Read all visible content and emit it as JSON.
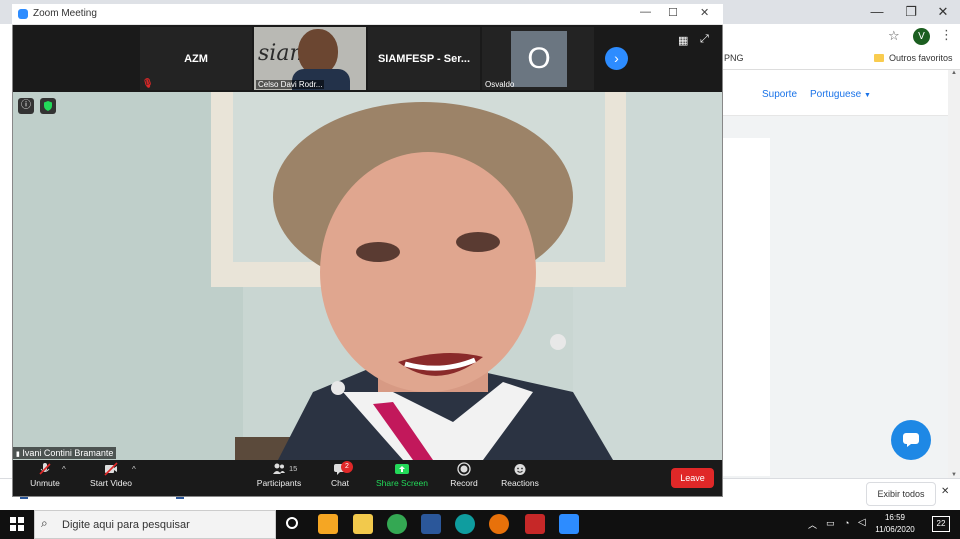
{
  "browser": {
    "bookmark_png": "PNG",
    "bookmark_folder": "Outros favoritos",
    "profile_initial": "V",
    "nav_support": "Suporte",
    "nav_language": "Portuguese",
    "show_all": "Exibir todos",
    "win_min": "—",
    "win_max": "❐",
    "win_close": "✕"
  },
  "zoom": {
    "title": "Zoom Meeting",
    "participants_strip": [
      {
        "name": "AZM",
        "type": "name-only"
      },
      {
        "name": "Celso Davi Rodr...",
        "type": "video"
      },
      {
        "name": "SIAMFESP - Ser...",
        "type": "name-only"
      },
      {
        "name": "Osvaldo",
        "initial": "O",
        "type": "avatar"
      }
    ],
    "speaker_name": "Ivani Contini Bramante",
    "controls": {
      "unmute": "Unmute",
      "start_video": "Start Video",
      "participants": "Participants",
      "participants_count": "15",
      "chat": "Chat",
      "chat_badge": "2",
      "share_screen": "Share Screen",
      "record": "Record",
      "reactions": "Reactions",
      "leave": "Leave"
    }
  },
  "taskbar": {
    "search_placeholder": "Digite aqui para pesquisar",
    "time": "16:59",
    "date": "11/06/2020",
    "notifications": "22"
  },
  "colors": {
    "zoom_accent": "#2d8cff",
    "leave_red": "#e02828",
    "share_green": "#23d959",
    "page_link": "#1a73e8"
  }
}
